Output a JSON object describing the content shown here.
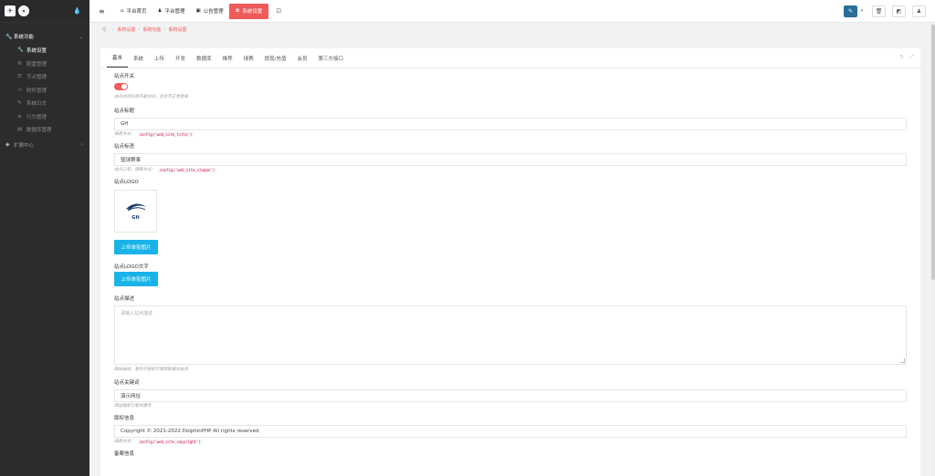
{
  "sidebar": {
    "drop_icon": "tint-icon",
    "groups": [
      {
        "label": "系统功能",
        "icon": "wrench-icon"
      },
      {
        "label": "扩展中心",
        "icon": "puzzle-icon"
      }
    ],
    "items": [
      {
        "label": "系统设置",
        "icon": "wrench-icon",
        "active": true
      },
      {
        "label": "配置管理",
        "icon": "cogs-icon"
      },
      {
        "label": "节点管理",
        "icon": "list-icon"
      },
      {
        "label": "附件管理",
        "icon": "folder-icon"
      },
      {
        "label": "系统日志",
        "icon": "book-icon"
      },
      {
        "label": "行为管理",
        "icon": "bars-icon"
      },
      {
        "label": "数据库管理",
        "icon": "database-icon"
      }
    ]
  },
  "topbar": {
    "nav": [
      {
        "label": "平台首页",
        "icon": "home-icon"
      },
      {
        "label": "平台管理",
        "icon": "user-icon"
      },
      {
        "label": "公告管理",
        "icon": "newspaper-icon"
      },
      {
        "label": "系统设置",
        "icon": "cog-icon",
        "active": true
      }
    ],
    "accent": "#ef5b5b"
  },
  "breadcrumb": [
    "系统设置",
    "系统功能",
    "系统设置"
  ],
  "tabs": [
    "基本",
    "系统",
    "上传",
    "开发",
    "数据库",
    "推荐",
    "球赛",
    "提现/充值",
    "会员",
    "第三方接口"
  ],
  "form": {
    "site_switch": {
      "label": "站点开关",
      "help": "站点关闭后将不能访问，后台可正常登录",
      "on": true
    },
    "site_title": {
      "label": "站点标题",
      "value": "GH",
      "help": "调用方式：",
      "code": "config('web_site_title')"
    },
    "site_slogan": {
      "label": "站点标语",
      "value": "篮球赛事",
      "help": "站点口号，调用方式：",
      "code": "config('web_site_slogan')"
    },
    "site_logo": {
      "label": "站点LOGO",
      "logo_text": "GH",
      "button": "上传单张图片"
    },
    "site_logo_text": {
      "label": "站点LOGO文字",
      "button": "上传单张图片"
    },
    "site_desc": {
      "label": "站点描述",
      "placeholder": "请输入站点描述",
      "help": "网站描述，有利于搜索引擎抓取相关信息"
    },
    "site_keywords": {
      "label": "站点关键词",
      "value": "演示网址",
      "help": "网站搜索引擎关键字"
    },
    "copyright": {
      "label": "版权信息",
      "value": "Copyright © 2021-2022 DolphinPHP All rights reserved.",
      "help": "调用方式：",
      "code": "config('web_site_copyright')"
    },
    "next_label": "备案信息"
  }
}
